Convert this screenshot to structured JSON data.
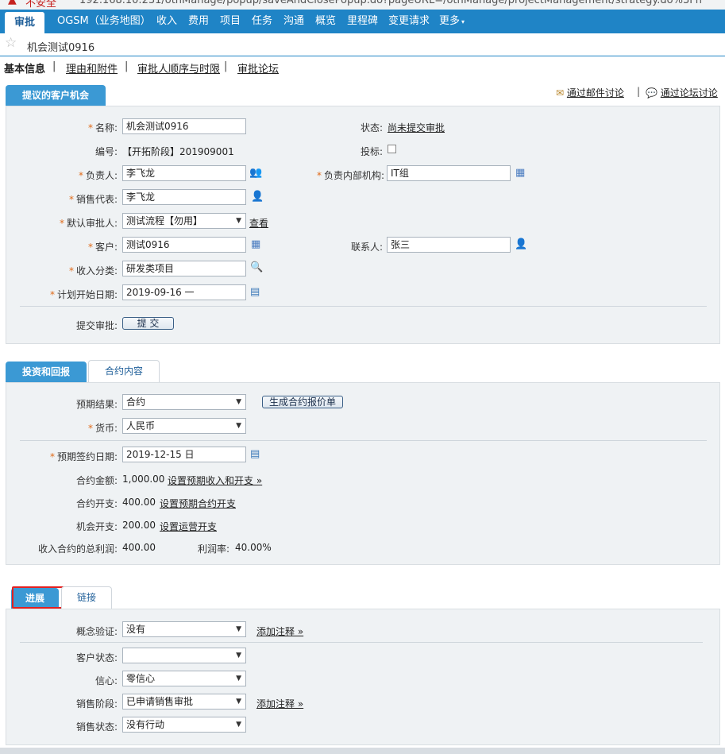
{
  "browser": {
    "insecure_label": "不安全",
    "url": "192.168.10.231/othManage/popup/saveAndClosePopup.do?pageURL=/othManage/projectManagement/strategy.do%3Fn"
  },
  "topnav": [
    "审批",
    "OGSM（业务地图）",
    "收入",
    "费用",
    "项目",
    "任务",
    "沟通",
    "概览",
    "里程碑",
    "变更请求",
    "更多"
  ],
  "page_title": "机会测试0916",
  "subnav": [
    "基本信息",
    "理由和附件",
    "审批人顺序与时限",
    "审批论坛"
  ],
  "discussion": {
    "email": "通过邮件讨论",
    "forum": "通过论坛讨论"
  },
  "opportunity": {
    "tab": "提议的客户机会",
    "name_label": "名称:",
    "name_value": "机会测试0916",
    "status_label": "状态:",
    "status_value": "尚未提交审批",
    "code_label": "编号:",
    "code_value": "【开拓阶段】201909001",
    "bid_label": "投标:",
    "owner_label": "负责人:",
    "owner_value": "李飞龙",
    "dept_label": "负责内部机构:",
    "dept_value": "IT组",
    "sales_label": "销售代表:",
    "sales_value": "李飞龙",
    "approver_label": "默认审批人:",
    "approver_value": "测试流程【勿用】",
    "approver_view": "查看",
    "customer_label": "客户:",
    "customer_value": "测试0916",
    "contact_label": "联系人:",
    "contact_value": "张三",
    "category_label": "收入分类:",
    "category_value": "研发类项目",
    "start_label": "计划开始日期:",
    "start_value": "2019-09-16 一",
    "submit_label": "提交审批:",
    "submit_button": "提 交"
  },
  "investment": {
    "tabs": [
      "投资和回报",
      "合约内容"
    ],
    "result_label": "预期结果:",
    "result_value": "合约",
    "quote_button": "生成合约报价单",
    "currency_label": "货币:",
    "currency_value": "人民币",
    "sign_label": "预期签约日期:",
    "sign_value": "2019-12-15 日",
    "amount_label": "合约金额:",
    "amount_value": "1,000.00",
    "amount_link": "设置预期收入和开支 »",
    "cost_label": "合约开支:",
    "cost_value": "400.00",
    "cost_link": "设置预期合约开支",
    "opp_cost_label": "机会开支:",
    "opp_cost_value": "200.00",
    "opp_cost_link": "设置运营开支",
    "profit_label": "收入合约的总利润:",
    "profit_value": "400.00",
    "margin_label": "利润率:",
    "margin_value": "40.00%"
  },
  "progress": {
    "tabs": [
      "进展",
      "链接"
    ],
    "poc_label": "概念验证:",
    "poc_value": "没有",
    "poc_link": "添加注释 »",
    "cust_status_label": "客户状态:",
    "cust_status_value": "",
    "confidence_label": "信心:",
    "confidence_value": "零信心",
    "stage_label": "销售阶段:",
    "stage_value": "已申请销售审批",
    "stage_link": "添加注释 »",
    "sales_status_label": "销售状态:",
    "sales_status_value": "没有行动"
  },
  "colors": {
    "nav": "#1f84c6",
    "tab": "#3b99d4",
    "panel": "#eff2f4",
    "required": "#e06b1a",
    "highlight": "#e32020"
  }
}
